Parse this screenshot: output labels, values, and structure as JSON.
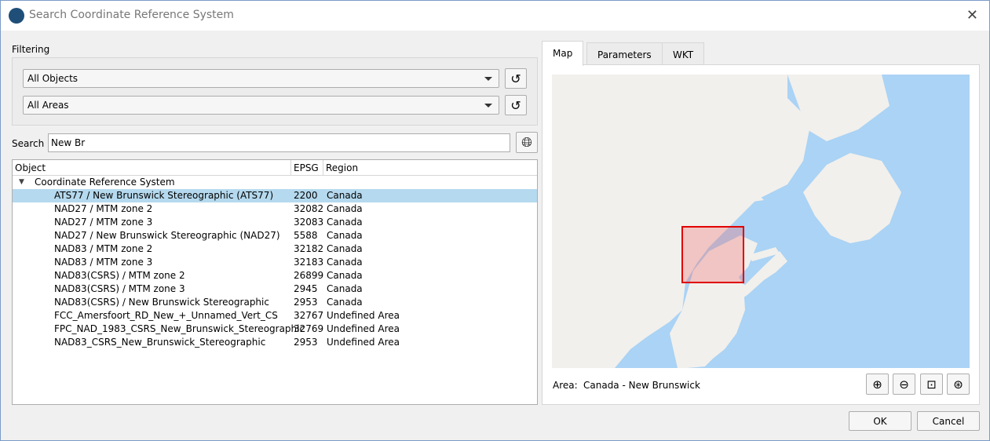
{
  "window": {
    "title": "Search Coordinate Reference System",
    "close_icon": "close-icon"
  },
  "filtering": {
    "label": "Filtering",
    "object_filter": "All Objects",
    "area_filter": "All Areas"
  },
  "search": {
    "label": "Search",
    "value": "New Br"
  },
  "table": {
    "headers": {
      "object": "Object",
      "epsg": "EPSG",
      "region": "Region"
    },
    "group": "Coordinate Reference System",
    "rows": [
      {
        "object": "ATS77 / New Brunswick Stereographic (ATS77)",
        "epsg": "2200",
        "region": "Canada"
      },
      {
        "object": "NAD27 / MTM zone 2",
        "epsg": "32082",
        "region": "Canada"
      },
      {
        "object": "NAD27 / MTM zone 3",
        "epsg": "32083",
        "region": "Canada"
      },
      {
        "object": "NAD27 / New Brunswick Stereographic (NAD27)",
        "epsg": "5588",
        "region": "Canada"
      },
      {
        "object": "NAD83 / MTM zone 2",
        "epsg": "32182",
        "region": "Canada"
      },
      {
        "object": "NAD83 / MTM zone 3",
        "epsg": "32183",
        "region": "Canada"
      },
      {
        "object": "NAD83(CSRS) / MTM zone 2",
        "epsg": "26899",
        "region": "Canada"
      },
      {
        "object": "NAD83(CSRS) / MTM zone 3",
        "epsg": "2945",
        "region": "Canada"
      },
      {
        "object": "NAD83(CSRS) / New Brunswick Stereographic",
        "epsg": "2953",
        "region": "Canada"
      },
      {
        "object": "FCC_Amersfoort_RD_New_+_Unnamed_Vert_CS",
        "epsg": "32767",
        "region": "Undefined Area"
      },
      {
        "object": "FPC_NAD_1983_CSRS_New_Brunswick_Stereographic",
        "epsg": "32769",
        "region": "Undefined Area"
      },
      {
        "object": "NAD83_CSRS_New_Brunswick_Stereographic",
        "epsg": "2953",
        "region": "Undefined Area"
      }
    ]
  },
  "tabs": [
    "Map",
    "Parameters",
    "WKT"
  ],
  "map": {
    "area_label": "Area:",
    "area_value": "Canada - New Brunswick",
    "water_color": "#aad3f5",
    "land_color": "#f2f0ec",
    "extent_color": "#e00000"
  },
  "buttons": {
    "ok": "OK",
    "cancel": "Cancel"
  }
}
